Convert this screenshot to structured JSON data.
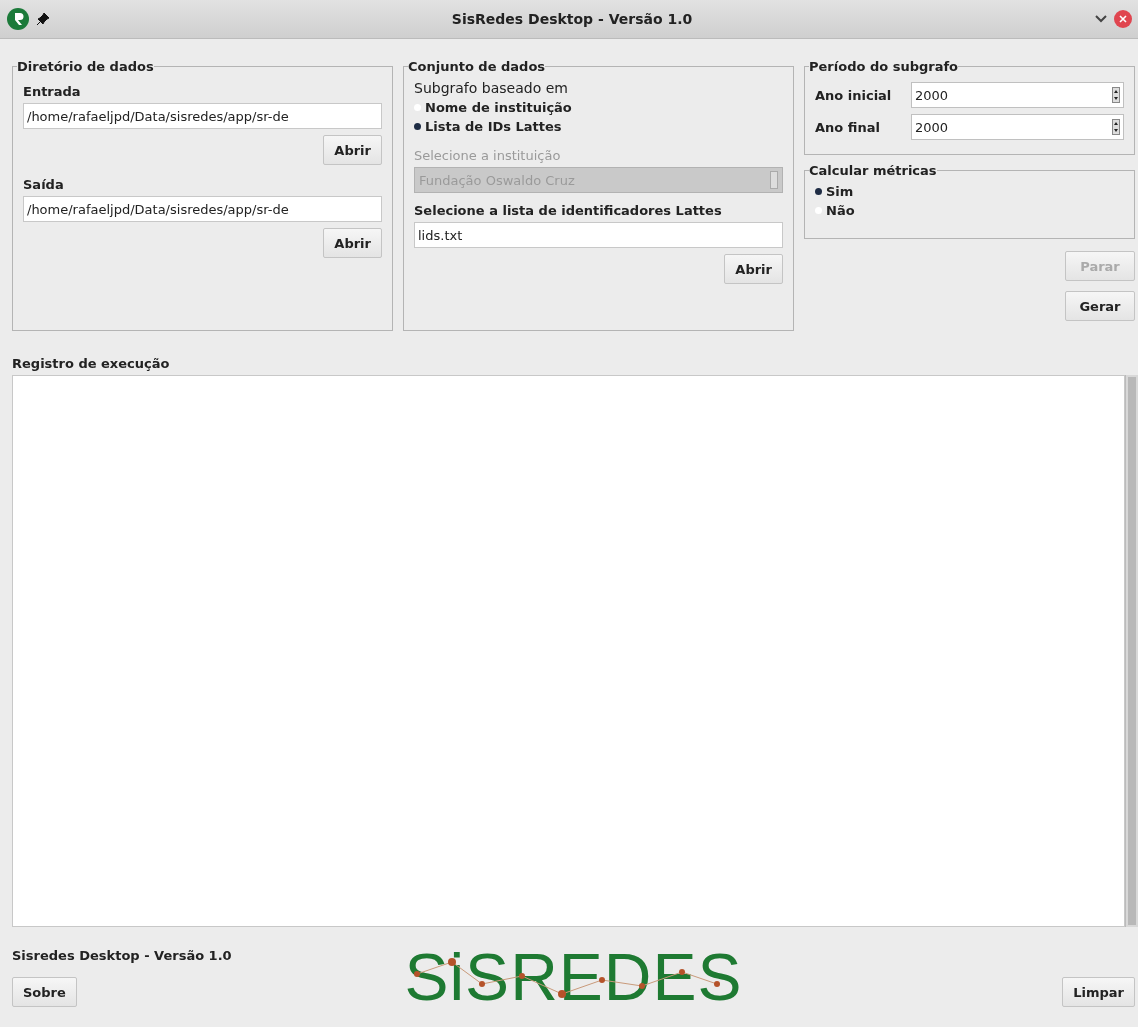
{
  "window": {
    "title": "SisRedes Desktop - Versão 1.0"
  },
  "data_directory": {
    "title": "Diretório de dados",
    "input": {
      "label": "Entrada",
      "value": "/home/rafaeljpd/Data/sisredes/app/sr-de",
      "button": "Abrir"
    },
    "output": {
      "label": "Saída",
      "value": "/home/rafaeljpd/Data/sisredes/app/sr-de",
      "button": "Abrir"
    }
  },
  "dataset": {
    "title": "Conjunto de dados",
    "subgraph_label": "Subgrafo baseado em",
    "options": [
      {
        "label": "Nome de instituição",
        "selected": false
      },
      {
        "label": "Lista de IDs Lattes",
        "selected": true
      }
    ],
    "institution": {
      "label": "Selecione a instituição",
      "value": "Fundação Oswaldo Cruz",
      "disabled": true
    },
    "ids_list": {
      "label": "Selecione a lista de identificadores Lattes",
      "value": "lids.txt",
      "button": "Abrir"
    }
  },
  "period": {
    "title": "Período do subgrafo",
    "fields": [
      {
        "label": "Ano inicial",
        "value": "2000"
      },
      {
        "label": "Ano final",
        "value": "2000"
      }
    ]
  },
  "metrics": {
    "title": "Calcular métricas",
    "options": [
      {
        "label": "Sim",
        "selected": true
      },
      {
        "label": "Não",
        "selected": false
      }
    ]
  },
  "actions": [
    {
      "label": "Parar",
      "disabled": true
    },
    {
      "label": "Gerar",
      "disabled": false
    }
  ],
  "log": {
    "label": "Registro de execução"
  },
  "footer": {
    "version": "Sisredes Desktop - Versão 1.0",
    "logo": "SiSREDES",
    "buttons": [
      "Sobre",
      "Limpar"
    ]
  }
}
